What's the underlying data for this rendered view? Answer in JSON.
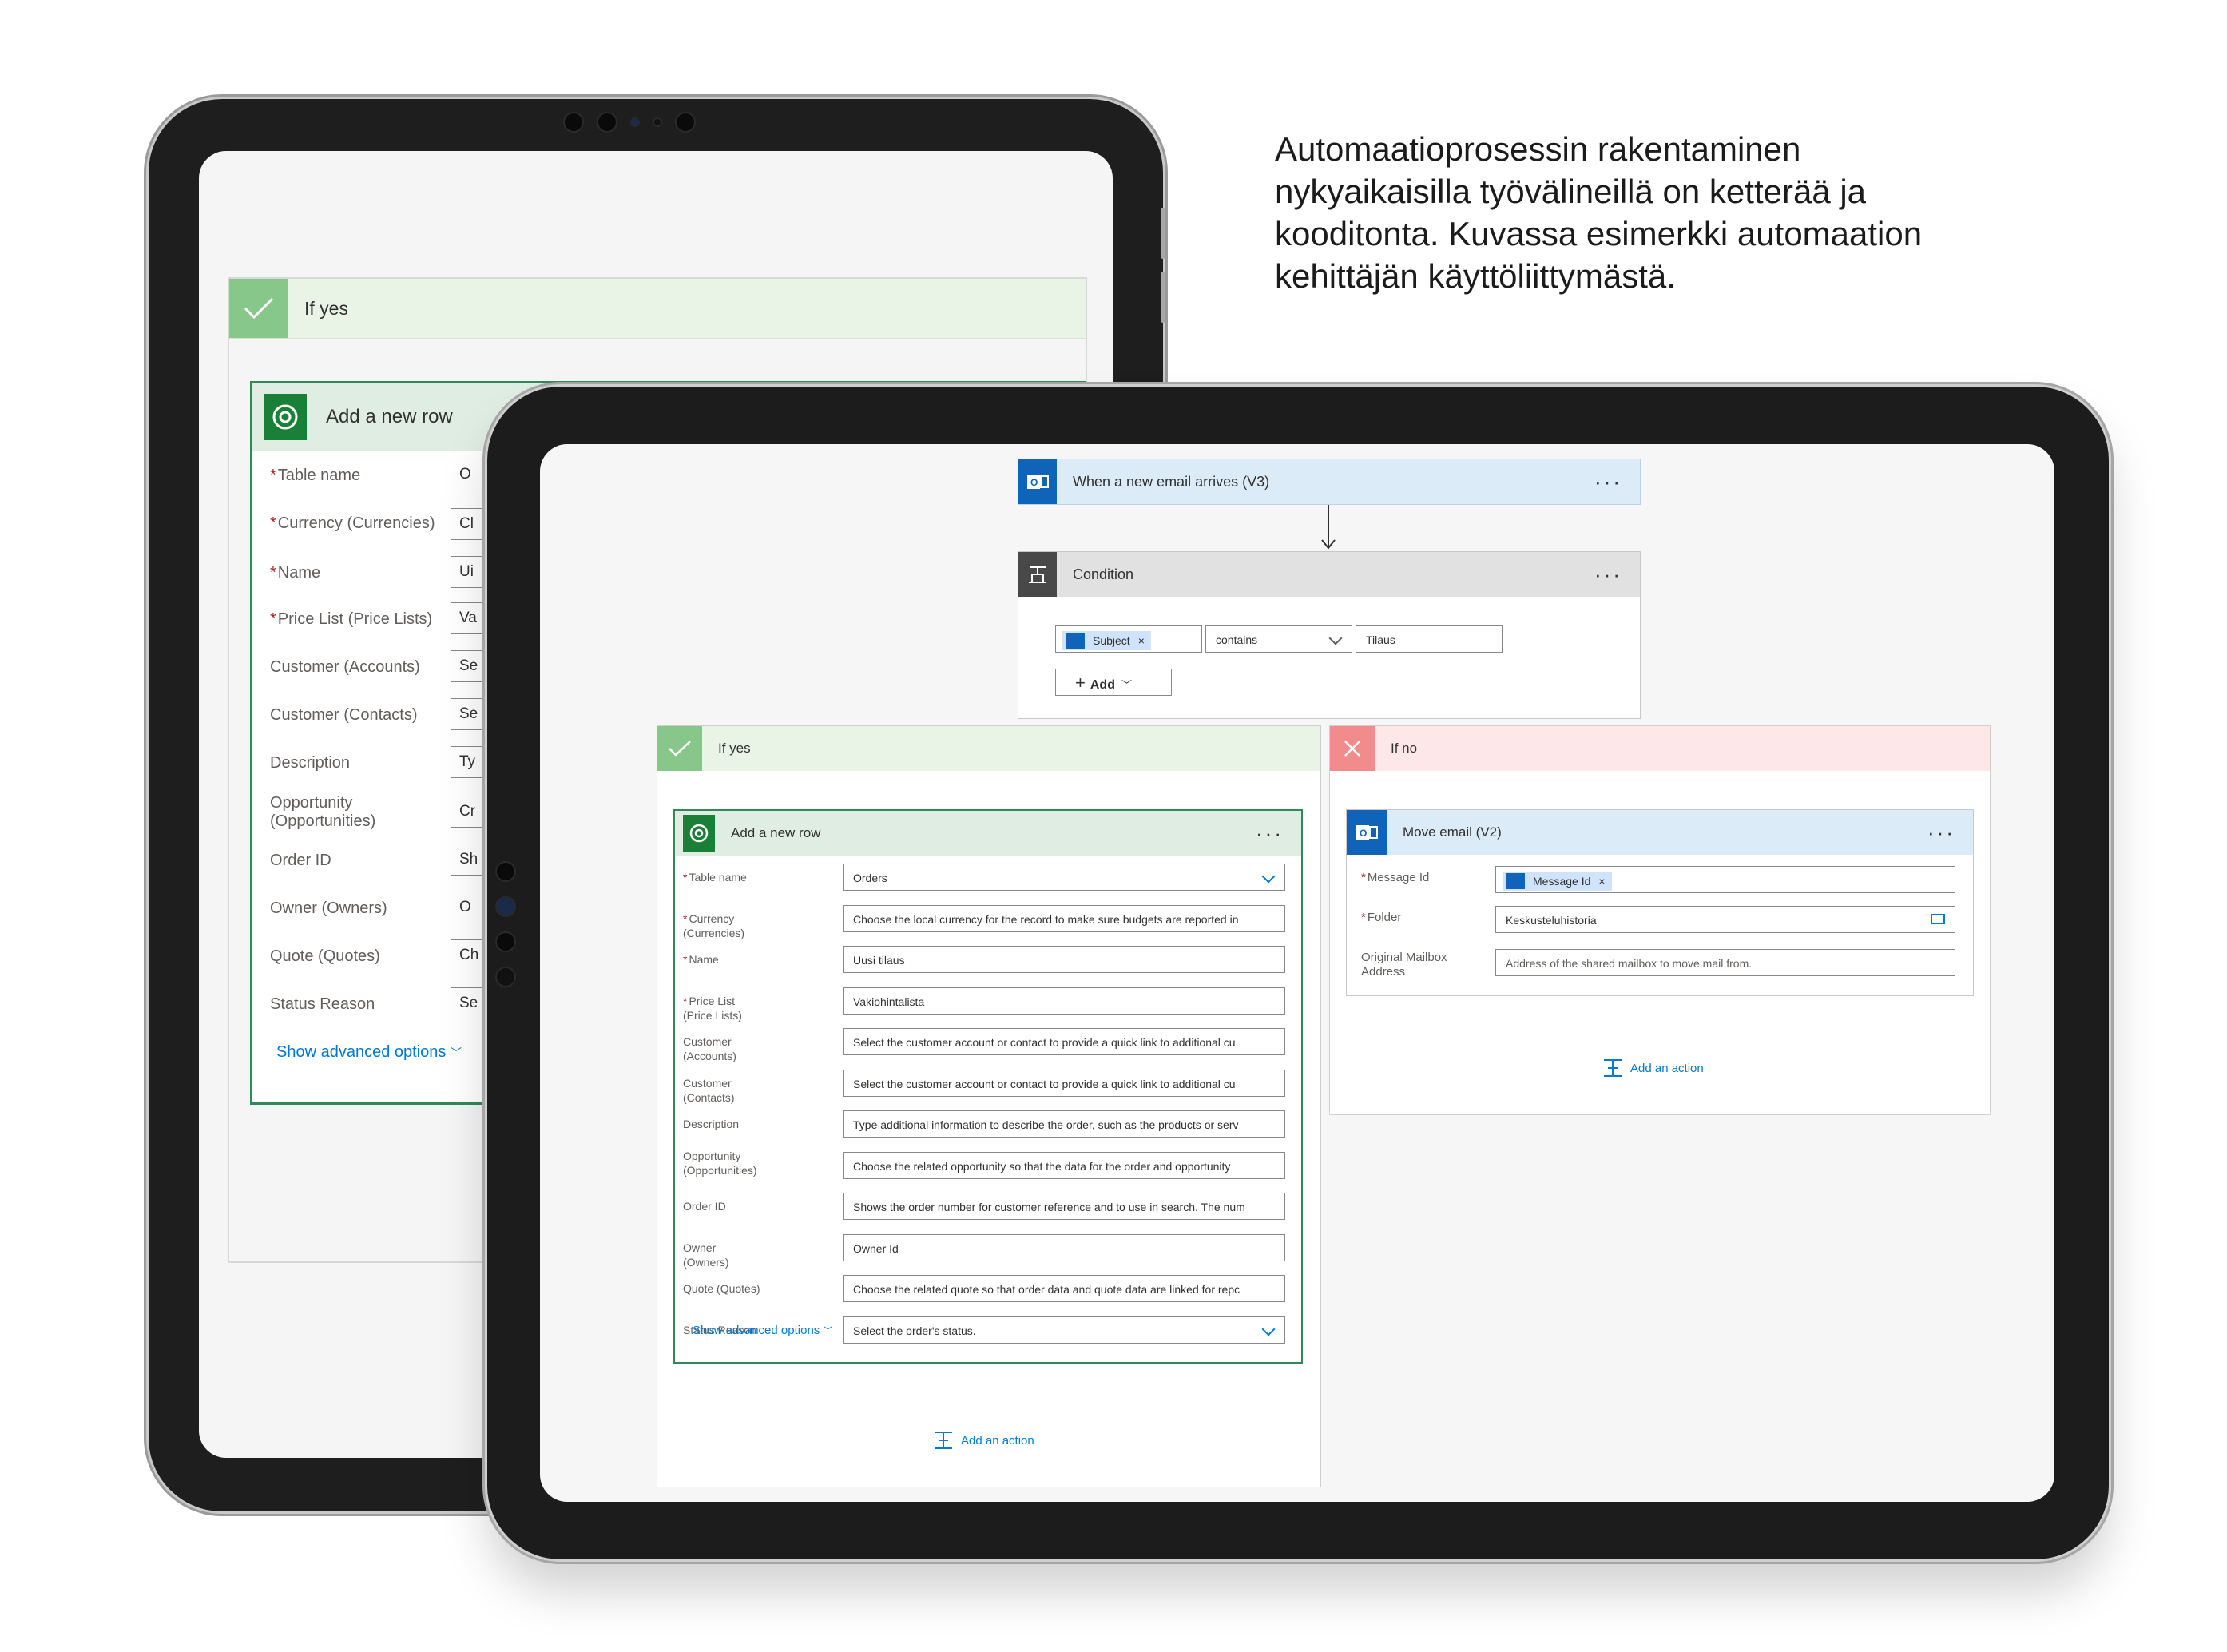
{
  "caption": [
    "Automaatioprosessin rakentaminen",
    "nykyaikaisilla työvälineillä on ketterää ja",
    "kooditonta. Kuvassa esimerkki automaation",
    "kehittäjän käyttöliittymästä."
  ],
  "back": {
    "if_yes": "If yes",
    "card_title": "Add a new row",
    "fields": [
      {
        "label": "Table name",
        "required": true,
        "value": "O"
      },
      {
        "label": "Currency (Currencies)",
        "required": true,
        "value": "Cl"
      },
      {
        "label": "Name",
        "required": true,
        "value": "Ui"
      },
      {
        "label": "Price List (Price Lists)",
        "required": true,
        "value": "Va"
      },
      {
        "label": "Customer (Accounts)",
        "required": false,
        "value": "Se"
      },
      {
        "label": "Customer (Contacts)",
        "required": false,
        "value": "Se"
      },
      {
        "label": "Description",
        "required": false,
        "value": "Ty"
      },
      {
        "label": "Opportunity (Opportunities)",
        "required": false,
        "value": "Cr"
      },
      {
        "label": "Order ID",
        "required": false,
        "value": "Sh"
      },
      {
        "label": "Owner (Owners)",
        "required": false,
        "value": "O"
      },
      {
        "label": "Quote (Quotes)",
        "required": false,
        "value": "Ch"
      },
      {
        "label": "Status Reason",
        "required": false,
        "value": "Se"
      }
    ],
    "show_advanced": "Show advanced options"
  },
  "front": {
    "trigger": {
      "title": "When a new email arrives (V3)",
      "more": "···"
    },
    "condition": {
      "title": "Condition",
      "more": "···",
      "left_token": "Subject",
      "operator": "contains",
      "right_value": "Tilaus",
      "add_label": "Add"
    },
    "if_yes": {
      "label": "If yes",
      "card_title": "Add a new row",
      "more": "···",
      "fields": [
        {
          "label": "Table name",
          "required": true,
          "value": "Orders",
          "dropdown": true
        },
        {
          "label": "Currency (Currencies)",
          "required": true,
          "value": "Choose the local currency for the record to make sure budgets are reported in"
        },
        {
          "label": "Name",
          "required": true,
          "value": "Uusi tilaus"
        },
        {
          "label": "Price List (Price Lists)",
          "required": true,
          "value": "Vakiohintalista"
        },
        {
          "label": "Customer (Accounts)",
          "required": false,
          "value": "Select the customer account or contact to provide a quick link to additional cu"
        },
        {
          "label": "Customer (Contacts)",
          "required": false,
          "value": "Select the customer account or contact to provide a quick link to additional cu"
        },
        {
          "label": "Description",
          "required": false,
          "value": "Type additional information to describe the order, such as the products or serv"
        },
        {
          "label": "Opportunity (Opportunities)",
          "required": false,
          "value": "Choose the related opportunity so that the data for the order and opportunity"
        },
        {
          "label": "Order ID",
          "required": false,
          "value": "Shows the order number for customer reference and to use in search. The num"
        },
        {
          "label": "Owner (Owners)",
          "required": false,
          "value": "Owner Id"
        },
        {
          "label": "Quote (Quotes)",
          "required": false,
          "value": "Choose the related quote so that order data and quote data are linked for repc"
        },
        {
          "label": "Status Reason",
          "required": false,
          "value": "Select the order's status.",
          "dropdown": true
        }
      ],
      "show_advanced": "Show advanced options",
      "add_action": "Add an action"
    },
    "if_no": {
      "label": "If no",
      "card_title": "Move email (V2)",
      "more": "···",
      "message_id_label": "Message Id",
      "message_id_token": "Message Id",
      "folder_label": "Folder",
      "folder_value": "Keskusteluhistoria",
      "mailbox_label": "Original Mailbox Address",
      "mailbox_placeholder": "Address of the shared mailbox to move mail from.",
      "add_action": "Add an action"
    }
  }
}
